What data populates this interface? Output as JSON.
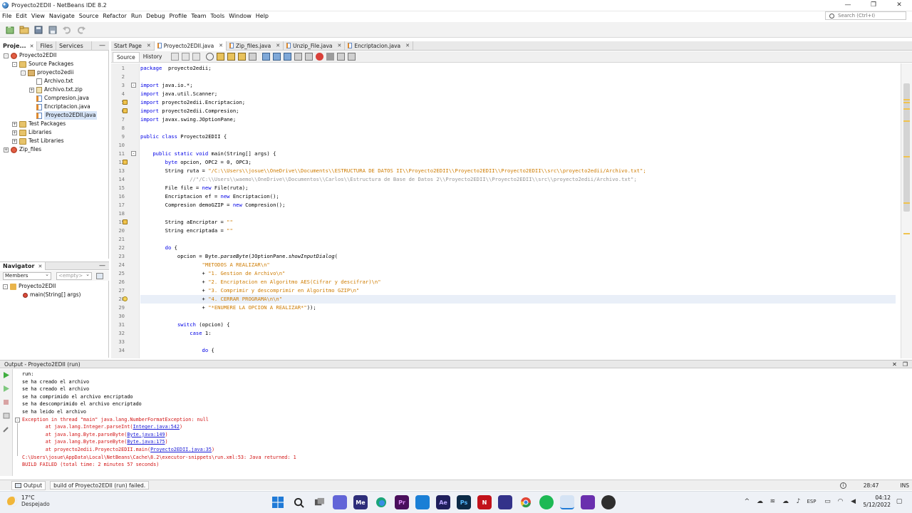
{
  "window": {
    "title": "Proyecto2EDII - NetBeans IDE 8.2"
  },
  "menu": [
    "File",
    "Edit",
    "View",
    "Navigate",
    "Source",
    "Refactor",
    "Run",
    "Debug",
    "Profile",
    "Team",
    "Tools",
    "Window",
    "Help"
  ],
  "search": {
    "placeholder": "Search (Ctrl+I)"
  },
  "left_tabs": [
    "Proje...",
    "Files",
    "Services"
  ],
  "project_tree": [
    {
      "label": "Proyecto2EDII",
      "depth": 0,
      "icon": "proj",
      "exp": "-"
    },
    {
      "label": "Source Packages",
      "depth": 1,
      "icon": "folder",
      "exp": "-"
    },
    {
      "label": "proyecto2edii",
      "depth": 2,
      "icon": "pkg",
      "exp": "-"
    },
    {
      "label": "Archivo.txt",
      "depth": 3,
      "icon": "file-txt",
      "exp": ""
    },
    {
      "label": "Archivo.txt.zip",
      "depth": 3,
      "icon": "file-zip",
      "exp": "+"
    },
    {
      "label": "Compresion.java",
      "depth": 3,
      "icon": "java",
      "exp": ""
    },
    {
      "label": "Encriptacion.java",
      "depth": 3,
      "icon": "java",
      "exp": ""
    },
    {
      "label": "Proyecto2EDII.java",
      "depth": 3,
      "icon": "java",
      "exp": "",
      "selected": true
    },
    {
      "label": "Test Packages",
      "depth": 1,
      "icon": "folder",
      "exp": "+"
    },
    {
      "label": "Libraries",
      "depth": 1,
      "icon": "folder",
      "exp": "+"
    },
    {
      "label": "Test Libraries",
      "depth": 1,
      "icon": "folder",
      "exp": "+"
    },
    {
      "label": "Zip_files",
      "depth": 0,
      "icon": "proj",
      "exp": "+"
    }
  ],
  "navigator": {
    "title": "Navigator",
    "filter": "Members",
    "empty": "<empty>",
    "items": [
      {
        "label": "Proyecto2EDII",
        "depth": 0
      },
      {
        "label": "main(String[] args)",
        "depth": 1
      }
    ]
  },
  "editor_tabs": [
    {
      "label": "Start Page",
      "active": false
    },
    {
      "label": "Proyecto2EDII.java",
      "active": true
    },
    {
      "label": "Zip_files.java",
      "active": false
    },
    {
      "label": "Unzip_File.java",
      "active": false
    },
    {
      "label": "Encriptacion.java",
      "active": false
    }
  ],
  "editor_sub": {
    "source": "Source",
    "history": "History"
  },
  "code_lines": [
    {
      "n": "1",
      "t": [
        [
          "kw",
          "package"
        ],
        [
          "",
          "  proyecto2edii;"
        ]
      ]
    },
    {
      "n": "2",
      "t": []
    },
    {
      "n": "3",
      "t": [
        [
          "kw",
          "import"
        ],
        [
          "",
          " java.io.*;"
        ]
      ],
      "fold": "-"
    },
    {
      "n": "4",
      "t": [
        [
          "kw",
          "import"
        ],
        [
          "",
          " java.util.Scanner;"
        ]
      ]
    },
    {
      "n": "5",
      "t": [
        [
          "kw",
          "import"
        ],
        [
          "",
          " proyecto2edii.Encriptacion;"
        ]
      ],
      "warn": true
    },
    {
      "n": "6",
      "t": [
        [
          "kw",
          "import"
        ],
        [
          "",
          " proyecto2edii.Compresion;"
        ]
      ],
      "warn": true
    },
    {
      "n": "7",
      "t": [
        [
          "kw",
          "import"
        ],
        [
          "",
          " javax.swing.JOptionPane;"
        ]
      ]
    },
    {
      "n": "8",
      "t": []
    },
    {
      "n": "9",
      "t": [
        [
          "kw",
          "public class"
        ],
        [
          "",
          " Proyecto2EDII {"
        ]
      ]
    },
    {
      "n": "10",
      "t": []
    },
    {
      "n": "11",
      "t": [
        [
          "",
          "    "
        ],
        [
          "kw",
          "public static void"
        ],
        [
          "",
          " main(String[] args) {"
        ]
      ],
      "fold": "-"
    },
    {
      "n": "12",
      "t": [
        [
          "",
          "        "
        ],
        [
          "kw",
          "byte"
        ],
        [
          "",
          " opcion, OPC2 = 0, OPC3;"
        ]
      ],
      "warn": true
    },
    {
      "n": "13",
      "t": [
        [
          "",
          "        String ruta = "
        ],
        [
          "str",
          "\"/C:\\\\Users\\\\josue\\\\OneDrive\\\\Documents\\\\ESTRUCTURA DE DATOS II\\\\Proyecto2EDII\\\\Proyecto2EDII\\\\Proyecto2EDII\\\\src\\\\proyecto2edii/Archivo.txt\";"
        ]
      ]
    },
    {
      "n": "14",
      "t": [
        [
          "",
          "                "
        ],
        [
          "cmt",
          "//\"/C:\\\\Users\\\\waemo\\\\OneDrive\\\\Documentos\\\\Carlos\\\\Estructura de Base de Datos 2\\\\Proyecto2EDII\\\\Proyecto2EDII\\\\src\\\\proyecto2edii/Archivo.txt\";"
        ]
      ]
    },
    {
      "n": "15",
      "t": [
        [
          "",
          "        File file = "
        ],
        [
          "kw",
          "new"
        ],
        [
          "",
          " File(ruta);"
        ]
      ]
    },
    {
      "n": "16",
      "t": [
        [
          "",
          "        Encriptacion ef = "
        ],
        [
          "kw",
          "new"
        ],
        [
          "",
          " Encriptacion();"
        ]
      ]
    },
    {
      "n": "17",
      "t": [
        [
          "",
          "        Compresion demoGZIP = "
        ],
        [
          "kw",
          "new"
        ],
        [
          "",
          " Compresion();"
        ]
      ]
    },
    {
      "n": "18",
      "t": []
    },
    {
      "n": "19",
      "t": [
        [
          "",
          "        String aEncriptar = "
        ],
        [
          "str",
          "\"\""
        ],
        [
          ";"
        ]
      ],
      "warn": true
    },
    {
      "n": "20",
      "t": [
        [
          "",
          "        String encriptada = "
        ],
        [
          "str",
          "\"\""
        ],
        [
          ";"
        ]
      ]
    },
    {
      "n": "21",
      "t": []
    },
    {
      "n": "22",
      "t": [
        [
          "",
          "        "
        ],
        [
          "kw",
          "do"
        ],
        [
          "",
          " {"
        ]
      ]
    },
    {
      "n": "23",
      "t": [
        [
          "",
          "            opcion = Byte."
        ],
        [
          "it",
          "parseByte"
        ],
        [
          "",
          "(JOptionPane."
        ],
        [
          "it",
          "showInputDialog"
        ],
        [
          "",
          "("
        ]
      ]
    },
    {
      "n": "24",
      "t": [
        [
          "",
          "                    "
        ],
        [
          "str",
          "\"METODOS A REALIZAR\\n\""
        ]
      ]
    },
    {
      "n": "25",
      "t": [
        [
          "",
          "                    + "
        ],
        [
          "str",
          "\"1. Gestion de Archivo\\n\""
        ]
      ]
    },
    {
      "n": "26",
      "t": [
        [
          "",
          "                    + "
        ],
        [
          "str",
          "\"2. Encriptacion en Algoritmo AES(Cifrar y descifrar)\\n\""
        ]
      ]
    },
    {
      "n": "27",
      "t": [
        [
          "",
          "                    + "
        ],
        [
          "str",
          "\"3. Comprimir y descomprimir en Algoritmo GZIP\\n\""
        ]
      ]
    },
    {
      "n": "28",
      "t": [
        [
          "",
          "                    + "
        ],
        [
          "str",
          "\"4. CERRAR PROGRAMA\\n\\n\""
        ]
      ],
      "hl": true,
      "bulb": true
    },
    {
      "n": "29",
      "t": [
        [
          "",
          "                    + "
        ],
        [
          "str",
          "\"*ENUMERE LA OPCION A REALIZAR*\""
        ],
        [
          "",
          "));"
        ]
      ]
    },
    {
      "n": "30",
      "t": []
    },
    {
      "n": "31",
      "t": [
        [
          "",
          "            "
        ],
        [
          "kw",
          "switch"
        ],
        [
          "",
          " (opcion) {"
        ]
      ]
    },
    {
      "n": "32",
      "t": [
        [
          "",
          "                "
        ],
        [
          "kw",
          "case"
        ],
        [
          "",
          " 1:"
        ]
      ]
    },
    {
      "n": "33",
      "t": []
    },
    {
      "n": "34",
      "t": [
        [
          "",
          "                    "
        ],
        [
          "kw",
          "do"
        ],
        [
          "",
          " {"
        ]
      ]
    }
  ],
  "output": {
    "title": "Output - Proyecto2EDII (run)",
    "lines": [
      {
        "c": "",
        "t": "run:"
      },
      {
        "c": "",
        "t": "se ha creado el archivo"
      },
      {
        "c": "",
        "t": "se ha creado el archivo"
      },
      {
        "c": "",
        "t": "se ha comprimido el archivo encriptado"
      },
      {
        "c": "",
        "t": "se ha descomprimido el archivo encriptado"
      },
      {
        "c": "",
        "t": "se ha leido el archivo"
      },
      {
        "c": "err",
        "t": "Exception in thread \"main\" java.lang.NumberFormatException: null"
      },
      {
        "c": "err",
        "t": "        at java.lang.Integer.parseInt(",
        "link": "Integer.java:542",
        "end": ")"
      },
      {
        "c": "err",
        "t": "        at java.lang.Byte.parseByte(",
        "link": "Byte.java:149",
        "end": ")"
      },
      {
        "c": "err",
        "t": "        at java.lang.Byte.parseByte(",
        "link": "Byte.java:175",
        "end": ")"
      },
      {
        "c": "err",
        "t": "        at proyecto2edii.Proyecto2EDII.main(",
        "link": "Proyecto2EDII.java:35",
        "end": ")"
      },
      {
        "c": "err",
        "t": "C:\\Users\\josue\\AppData\\Local\\NetBeans\\Cache\\8.2\\executor-snippets\\run.xml:53: Java returned: 1"
      },
      {
        "c": "err",
        "t": "BUILD FAILED (total time: 2 minutes 57 seconds)"
      }
    ]
  },
  "statusbar": {
    "output_tab": "Output",
    "message": "build of Proyecto2EDII (run) failed.",
    "position": "28:47",
    "mode": "INS"
  },
  "taskbar": {
    "temp": "17°C",
    "weather": "Despejado",
    "lang": "ESP",
    "time": "04:12",
    "date": "5/12/2022"
  },
  "colors": {
    "keyword": "#0000e6",
    "string": "#ce7b00",
    "comment": "#969696",
    "error": "#d21414"
  }
}
